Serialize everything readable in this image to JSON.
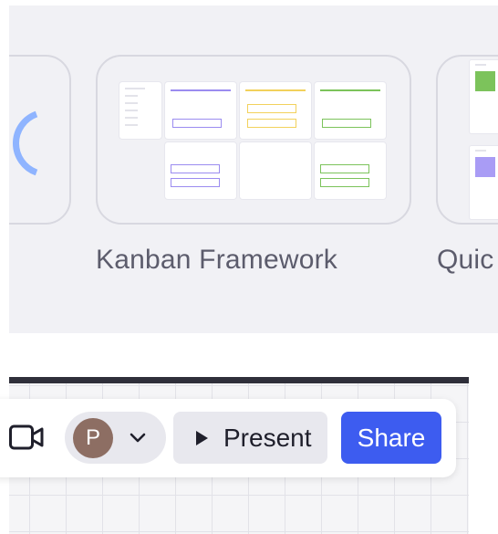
{
  "gallery": {
    "templates": [
      {
        "label": ""
      },
      {
        "label": "Kanban Framework"
      },
      {
        "label": "Quic"
      }
    ]
  },
  "toolbar": {
    "video_icon": "video-camera-icon",
    "avatar_initial": "P",
    "avatar_color": "#8d6e63",
    "chevron_icon": "chevron-down-icon",
    "present_label": "Present",
    "play_icon": "play-icon",
    "share_label": "Share",
    "share_color": "#3d5cf0"
  }
}
